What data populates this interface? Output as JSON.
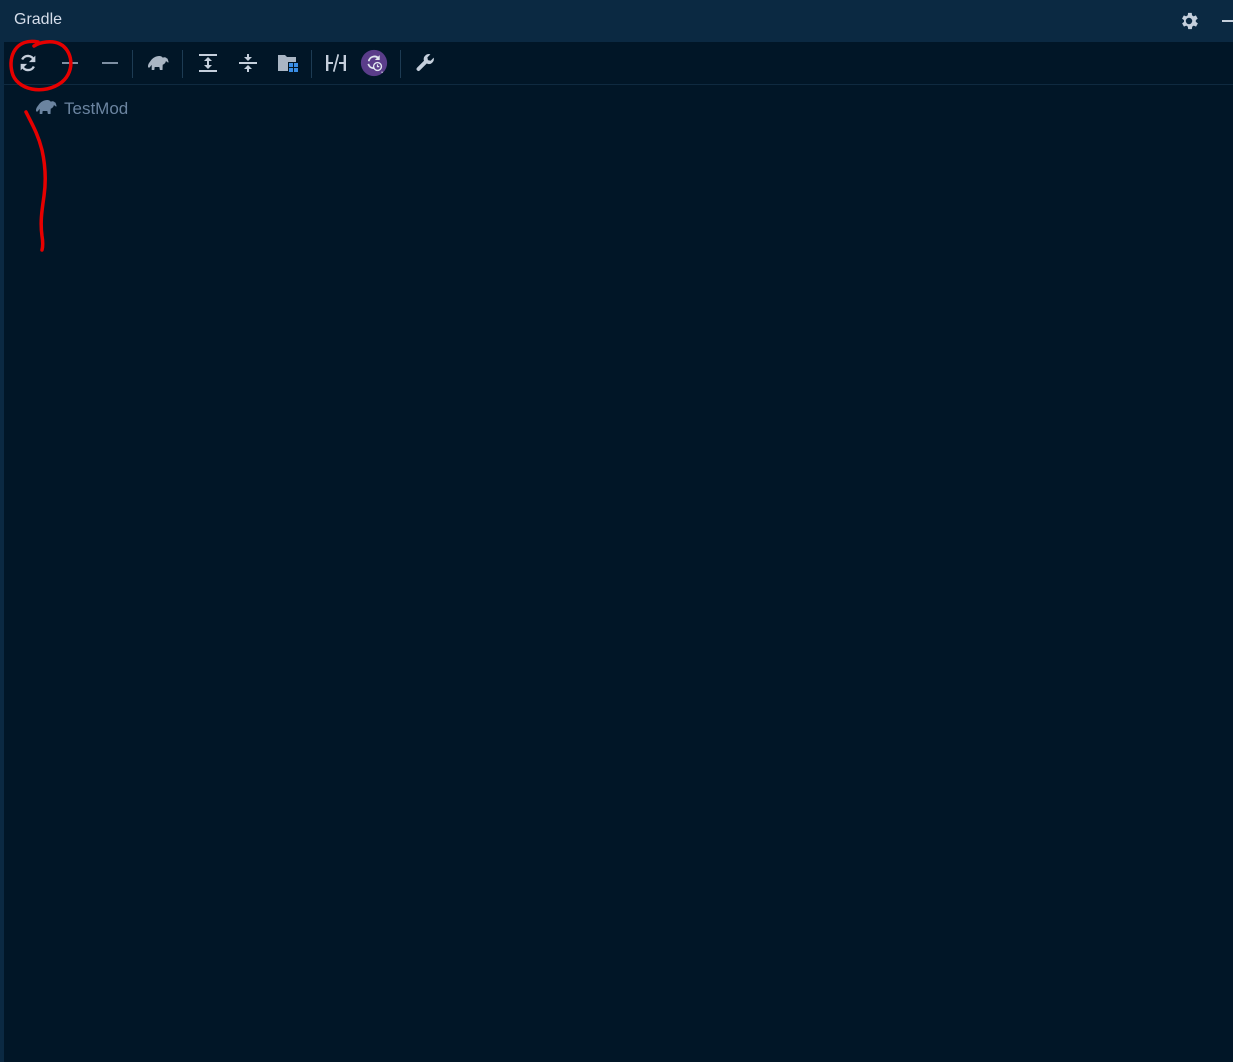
{
  "header": {
    "title": "Gradle",
    "settings_icon": "gear-icon",
    "minimize_icon": "minimize-icon"
  },
  "toolbar": {
    "buttons": [
      {
        "icon": "refresh-icon"
      },
      {
        "icon": "plus-icon"
      },
      {
        "icon": "minus-icon"
      },
      {
        "icon": "elephant-icon"
      },
      {
        "icon": "expand-all-icon"
      },
      {
        "icon": "collapse-all-icon"
      },
      {
        "icon": "folder-grid-icon"
      },
      {
        "icon": "toggle-offline-icon"
      },
      {
        "icon": "history-icon"
      },
      {
        "icon": "wrench-icon"
      }
    ]
  },
  "tree": {
    "items": [
      {
        "label": "TestMod",
        "icon": "elephant-icon"
      }
    ]
  },
  "colors": {
    "background": "#011627",
    "header": "#0b2942",
    "text": "#d6deeb",
    "muted_text": "#6b84a0",
    "icon": "#c5cfdc",
    "accent_purple": "#5a3d8a",
    "annotation_red": "#e60000"
  }
}
